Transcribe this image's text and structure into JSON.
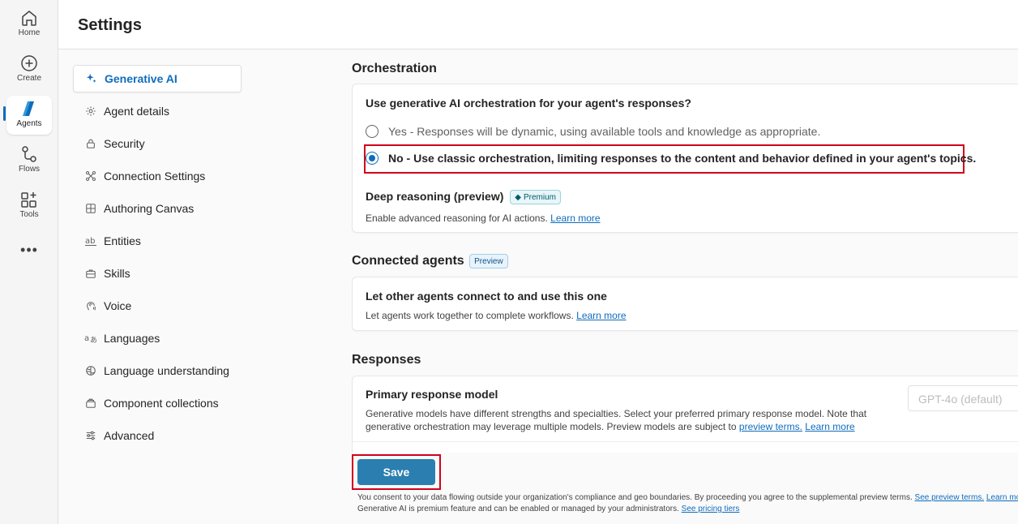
{
  "rail": {
    "items": [
      {
        "label": "Home",
        "icon": "home-icon"
      },
      {
        "label": "Create",
        "icon": "create-icon"
      },
      {
        "label": "Agents",
        "icon": "agents-icon"
      },
      {
        "label": "Flows",
        "icon": "flows-icon"
      },
      {
        "label": "Tools",
        "icon": "tools-icon"
      }
    ],
    "more": "•••"
  },
  "header": {
    "title": "Settings"
  },
  "nav": {
    "items": [
      {
        "label": "Generative AI",
        "icon": "sparkle-icon"
      },
      {
        "label": "Agent details",
        "icon": "gear-icon"
      },
      {
        "label": "Security",
        "icon": "lock-icon"
      },
      {
        "label": "Connection Settings",
        "icon": "connection-icon"
      },
      {
        "label": "Authoring Canvas",
        "icon": "grid-icon"
      },
      {
        "label": "Entities",
        "icon": "entities-icon"
      },
      {
        "label": "Skills",
        "icon": "briefcase-icon"
      },
      {
        "label": "Voice",
        "icon": "voice-icon"
      },
      {
        "label": "Languages",
        "icon": "languages-icon"
      },
      {
        "label": "Language understanding",
        "icon": "brain-icon"
      },
      {
        "label": "Component collections",
        "icon": "collection-icon"
      },
      {
        "label": "Advanced",
        "icon": "sliders-icon"
      }
    ]
  },
  "orchestration": {
    "title": "Orchestration",
    "question": "Use generative AI orchestration for your agent's responses?",
    "option_yes": "Yes - Responses will be dynamic, using available tools and knowledge as appropriate.",
    "option_no": "No - Use classic orchestration, limiting responses to the content and behavior defined in your agent's topics.",
    "deep_reasoning_title": "Deep reasoning (preview)",
    "premium_badge": "Premium",
    "deep_reasoning_desc": "Enable advanced reasoning for AI actions.",
    "learn_more": "Learn more"
  },
  "connected": {
    "title": "Connected agents",
    "badge": "Preview",
    "heading": "Let other agents connect to and use this one",
    "desc": "Let agents work together to complete workflows.",
    "learn_more": "Learn more"
  },
  "responses": {
    "title": "Responses",
    "model_heading": "Primary response model",
    "model_desc_1": "Generative models have different strengths and specialties. Select your preferred primary response model. Note that",
    "model_desc_2": "generative orchestration may leverage multiple models. Preview models are subject to",
    "preview_terms": "preview terms.",
    "learn_more": "Learn more",
    "model_value": "GPT-4o (default)"
  },
  "footer": {
    "save": "Save",
    "line1": "You consent to your data flowing outside your organization's compliance and geo boundaries. By proceeding you agree to the supplemental preview terms.",
    "see_preview_terms": "See preview terms.",
    "learn_more": "Learn mo",
    "line2": "Generative AI is premium feature and can be enabled or managed by your administrators.",
    "see_pricing": "See pricing tiers"
  },
  "colors": {
    "accent": "#0f6cbd",
    "save": "#2b7fb0",
    "highlight": "#d0021b"
  }
}
